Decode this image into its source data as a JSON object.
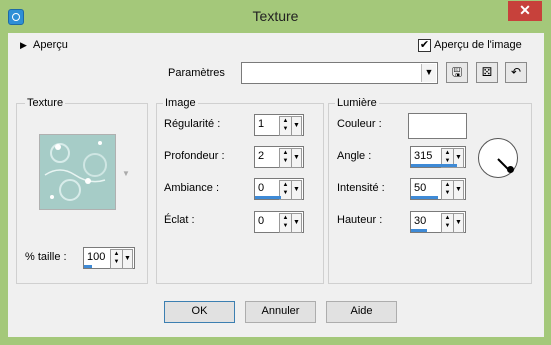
{
  "window": {
    "title": "Texture",
    "close_label": "✕"
  },
  "top": {
    "apercu_label": "Aperçu",
    "apercu_image_label": "Aperçu de l'image",
    "apercu_image_checked": true,
    "parametres_label": "Paramètres",
    "parametres_value": ""
  },
  "texture_group": {
    "title": "Texture",
    "taille_label": "% taille :",
    "taille_value": "100"
  },
  "image_group": {
    "title": "Image",
    "regularite_label": "Régularité :",
    "regularite_value": "1",
    "profondeur_label": "Profondeur :",
    "profondeur_value": "2",
    "ambiance_label": "Ambiance :",
    "ambiance_value": "0",
    "eclat_label": "Éclat :",
    "eclat_value": "0"
  },
  "lumiere_group": {
    "title": "Lumière",
    "couleur_label": "Couleur :",
    "couleur_value": "#ffffff",
    "angle_label": "Angle :",
    "angle_value": "315",
    "intensite_label": "Intensité :",
    "intensite_value": "50",
    "hauteur_label": "Hauteur :",
    "hauteur_value": "30"
  },
  "buttons": {
    "ok": "OK",
    "annuler": "Annuler",
    "aide": "Aide"
  }
}
